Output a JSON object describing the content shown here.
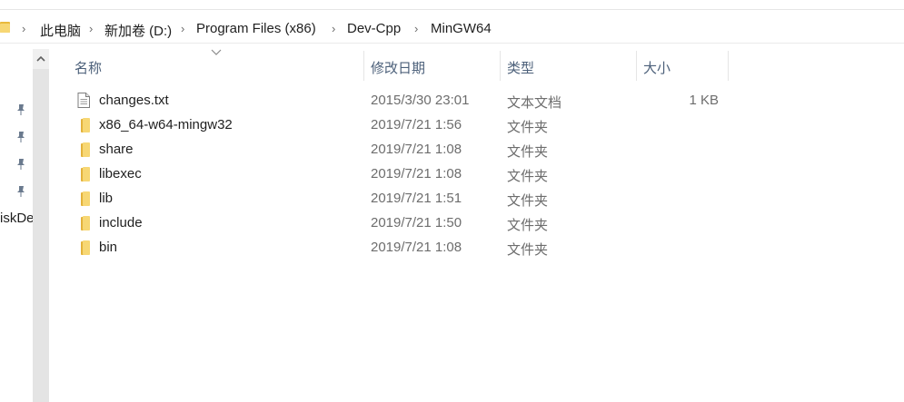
{
  "breadcrumb": {
    "items": [
      "此电脑",
      "新加卷 (D:)",
      "Program Files (x86)",
      "Dev-Cpp",
      "MinGW64"
    ]
  },
  "nav_pane": {
    "partial_label": "iskDe"
  },
  "columns": {
    "name": "名称",
    "date": "修改日期",
    "type": "类型",
    "size": "大小"
  },
  "files": [
    {
      "name": "changes.txt",
      "date": "2015/3/30 23:01",
      "type": "文本文档",
      "size": "1 KB",
      "icon": "text-file-icon"
    },
    {
      "name": "x86_64-w64-mingw32",
      "date": "2019/7/21 1:56",
      "type": "文件夹",
      "size": "",
      "icon": "folder-icon"
    },
    {
      "name": "share",
      "date": "2019/7/21 1:08",
      "type": "文件夹",
      "size": "",
      "icon": "folder-icon"
    },
    {
      "name": "libexec",
      "date": "2019/7/21 1:08",
      "type": "文件夹",
      "size": "",
      "icon": "folder-icon"
    },
    {
      "name": "lib",
      "date": "2019/7/21 1:51",
      "type": "文件夹",
      "size": "",
      "icon": "folder-icon"
    },
    {
      "name": "include",
      "date": "2019/7/21 1:50",
      "type": "文件夹",
      "size": "",
      "icon": "folder-icon"
    },
    {
      "name": "bin",
      "date": "2019/7/21 1:08",
      "type": "文件夹",
      "size": "",
      "icon": "folder-icon"
    }
  ],
  "colors": {
    "folder": "#f7d774",
    "header_text": "#4c607a",
    "secondary_text": "#6d6d6d"
  }
}
